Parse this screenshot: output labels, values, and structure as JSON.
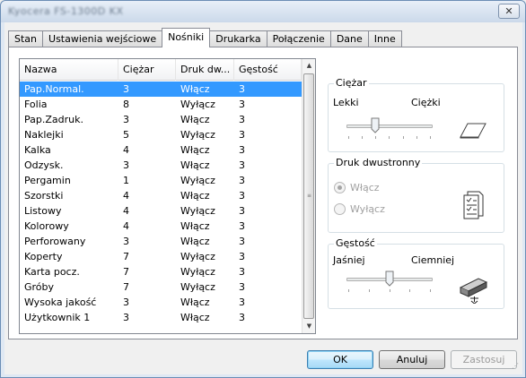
{
  "window": {
    "title": "Kyocera FS-1300D KX",
    "close_glyph": "✕"
  },
  "tabs": [
    {
      "label": "Stan"
    },
    {
      "label": "Ustawienia wejściowe"
    },
    {
      "label": "Nośniki"
    },
    {
      "label": "Drukarka"
    },
    {
      "label": "Połączenie"
    },
    {
      "label": "Dane"
    },
    {
      "label": "Inne"
    }
  ],
  "active_tab": "Nośniki",
  "media_list": {
    "columns": [
      "Nazwa",
      "Ciężar",
      "Druk dw...",
      "Gęstość"
    ],
    "rows": [
      [
        "Pap.Normal.",
        "3",
        "Włącz",
        "3"
      ],
      [
        "Folia",
        "8",
        "Wyłącz",
        "3"
      ],
      [
        "Pap.Zadruk.",
        "3",
        "Włącz",
        "3"
      ],
      [
        "Naklejki",
        "5",
        "Wyłącz",
        "3"
      ],
      [
        "Kalka",
        "4",
        "Włącz",
        "3"
      ],
      [
        "Odzysk.",
        "3",
        "Włącz",
        "3"
      ],
      [
        "Pergamin",
        "1",
        "Wyłącz",
        "3"
      ],
      [
        "Szorstki",
        "4",
        "Włącz",
        "3"
      ],
      [
        "Listowy",
        "4",
        "Wyłącz",
        "3"
      ],
      [
        "Kolorowy",
        "4",
        "Włącz",
        "3"
      ],
      [
        "Perforowany",
        "3",
        "Włącz",
        "3"
      ],
      [
        "Koperty",
        "7",
        "Wyłącz",
        "3"
      ],
      [
        "Karta pocz.",
        "7",
        "Wyłącz",
        "3"
      ],
      [
        "Gróby",
        "7",
        "Wyłącz",
        "3"
      ],
      [
        "Wysoka jakość",
        "3",
        "Włącz",
        "3"
      ],
      [
        "Użytkownik 1",
        "3",
        "Włącz",
        "3"
      ]
    ],
    "selected_row": 0
  },
  "weight_group": {
    "title": "Ciężar",
    "min_label": "Lekki",
    "max_label": "Ciężki",
    "slider_level": 0.33,
    "icon": "paper-sheet-icon"
  },
  "duplex_group": {
    "title": "Druk dwustronny",
    "options": [
      "Włącz",
      "Wyłącz"
    ],
    "selected": "Włącz",
    "icon": "duplex-document-icon"
  },
  "density_group": {
    "title": "Gęstość",
    "min_label": "Jaśniej",
    "max_label": "Ciemniej",
    "slider_level": 0.5,
    "icon": "toner-cartridge-icon"
  },
  "buttons": {
    "ok": "OK",
    "cancel": "Anuluj",
    "apply": "Zastosuj"
  },
  "colors": {
    "selection": "#3399ff",
    "ok_button": "#a7d9f5"
  }
}
